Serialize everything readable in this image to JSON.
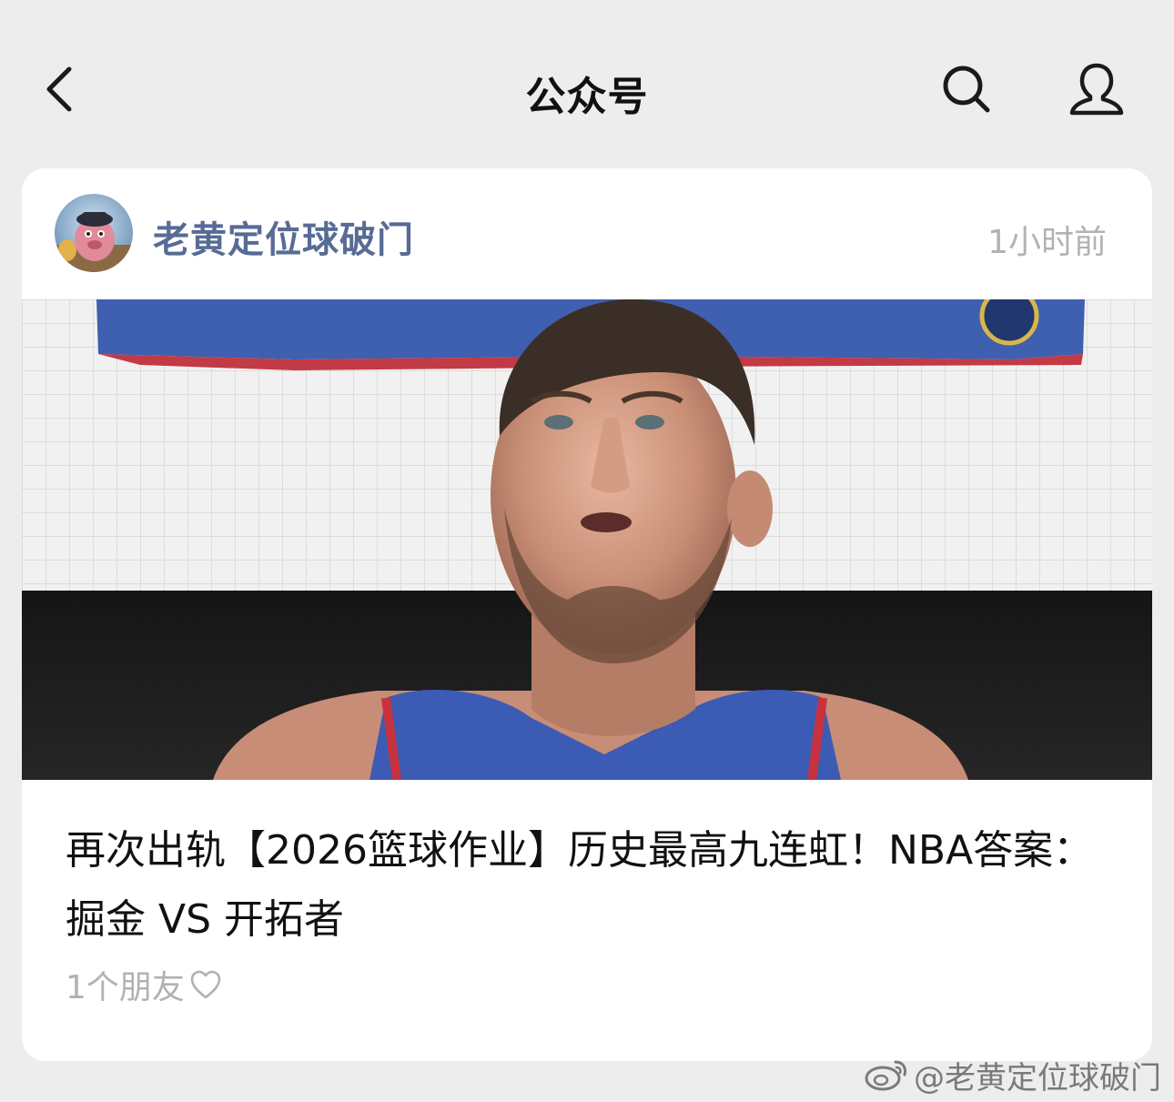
{
  "nav": {
    "title": "公众号",
    "back_icon": "chevron-left-icon",
    "search_icon": "search-icon",
    "profile_icon": "user-icon"
  },
  "post": {
    "account_name": "老黄定位球破门",
    "timestamp": "1小时前",
    "title": "再次出轨【2026篮球作业】历史最高九连虹！NBA答案：掘金 VS 开拓者",
    "friends": "1个朋友",
    "friends_icon": "heart-outline-icon"
  },
  "watermark": {
    "text": "@老黄定位球破门",
    "logo_icon": "weibo-logo-icon"
  },
  "colors": {
    "background": "#ededed",
    "card": "#ffffff",
    "account_name": "#576b95",
    "muted": "#b2b2b2",
    "title": "#111111"
  }
}
